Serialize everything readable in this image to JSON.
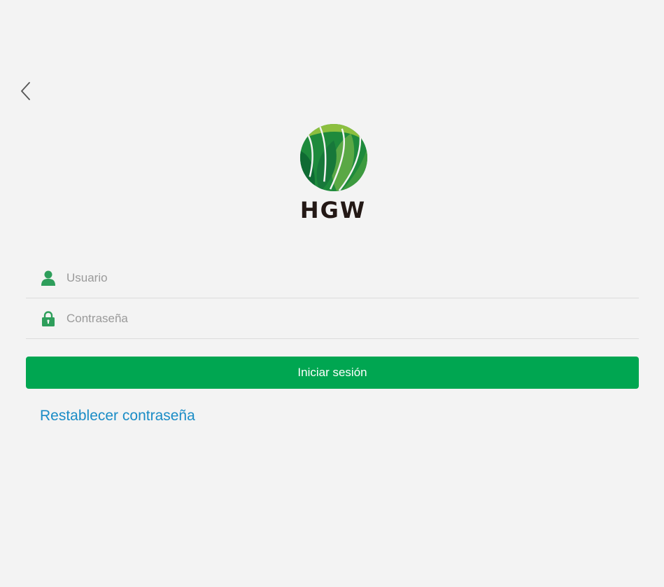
{
  "header": {
    "back_icon": "chevron-left-icon"
  },
  "logo": {
    "text": "HGW"
  },
  "form": {
    "username_placeholder": "Usuario",
    "username_value": "",
    "username_icon": "user-icon",
    "password_placeholder": "Contraseña",
    "password_value": "",
    "password_icon": "lock-icon",
    "login_label": "Iniciar sesión",
    "reset_label": "Restablecer contraseña"
  },
  "colors": {
    "accent": "#00a651",
    "link": "#1a8cc6",
    "icon": "#2e9e5b",
    "background": "#f3f3f3"
  }
}
